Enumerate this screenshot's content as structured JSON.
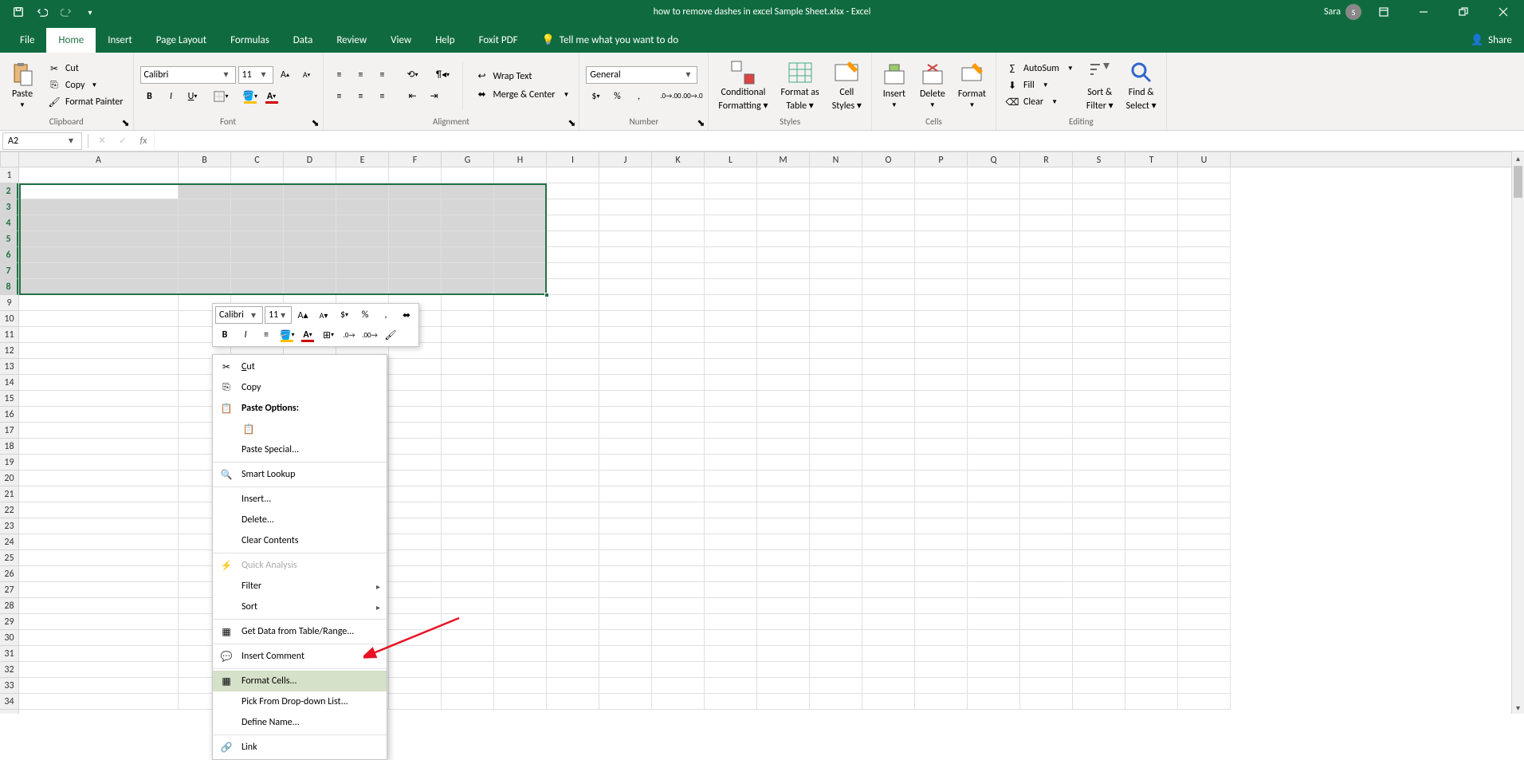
{
  "titlebar": {
    "title": "how to remove dashes in excel Sample Sheet.xlsx - Excel",
    "user_name": "Sara",
    "user_initial": "S"
  },
  "tabs": {
    "file": "File",
    "home": "Home",
    "insert": "Insert",
    "pagelayout": "Page Layout",
    "formulas": "Formulas",
    "data": "Data",
    "review": "Review",
    "view": "View",
    "help": "Help",
    "foxit": "Foxit PDF",
    "tellme": "Tell me what you want to do",
    "share": "Share"
  },
  "ribbon": {
    "clipboard": {
      "label": "Clipboard",
      "paste": "Paste",
      "cut": "Cut",
      "copy": "Copy",
      "painter": "Format Painter"
    },
    "font": {
      "label": "Font",
      "name": "Calibri",
      "size": "11"
    },
    "alignment": {
      "label": "Alignment",
      "wrap": "Wrap Text",
      "merge": "Merge & Center"
    },
    "number": {
      "label": "Number",
      "format": "General"
    },
    "styles": {
      "label": "Styles",
      "cond1": "Conditional",
      "cond2": "Formatting",
      "fmt1": "Format as",
      "fmt2": "Table",
      "cell1": "Cell",
      "cell2": "Styles"
    },
    "cells": {
      "label": "Cells",
      "insert": "Insert",
      "delete": "Delete",
      "format": "Format"
    },
    "editing": {
      "label": "Editing",
      "autosum": "AutoSum",
      "fill": "Fill",
      "clear": "Clear",
      "sort1": "Sort &",
      "sort2": "Filter",
      "find1": "Find &",
      "find2": "Select"
    }
  },
  "formula_bar": {
    "namebox": "A2",
    "fx": "fx"
  },
  "grid": {
    "col_width_a": 200,
    "col_width_other": 66,
    "columns": [
      "A",
      "B",
      "C",
      "D",
      "E",
      "F",
      "G",
      "H",
      "I",
      "J",
      "K",
      "L",
      "M",
      "N",
      "O",
      "P",
      "Q",
      "R",
      "S",
      "T",
      "U"
    ],
    "row_count": 34,
    "selected_rows": [
      2,
      3,
      4,
      5,
      6,
      7,
      8
    ]
  },
  "mini_toolbar": {
    "font": "Calibri",
    "size": "11"
  },
  "context_menu": {
    "cut": "Cut",
    "copy": "Copy",
    "paste_options": "Paste Options:",
    "paste_special": "Paste Special...",
    "smart_lookup": "Smart Lookup",
    "insert": "Insert...",
    "delete": "Delete...",
    "clear": "Clear Contents",
    "quick": "Quick Analysis",
    "filter": "Filter",
    "sort": "Sort",
    "getdata": "Get Data from Table/Range...",
    "comment": "Insert Comment",
    "format_cells": "Format Cells...",
    "pick": "Pick From Drop-down List...",
    "define": "Define Name...",
    "link": "Link"
  }
}
